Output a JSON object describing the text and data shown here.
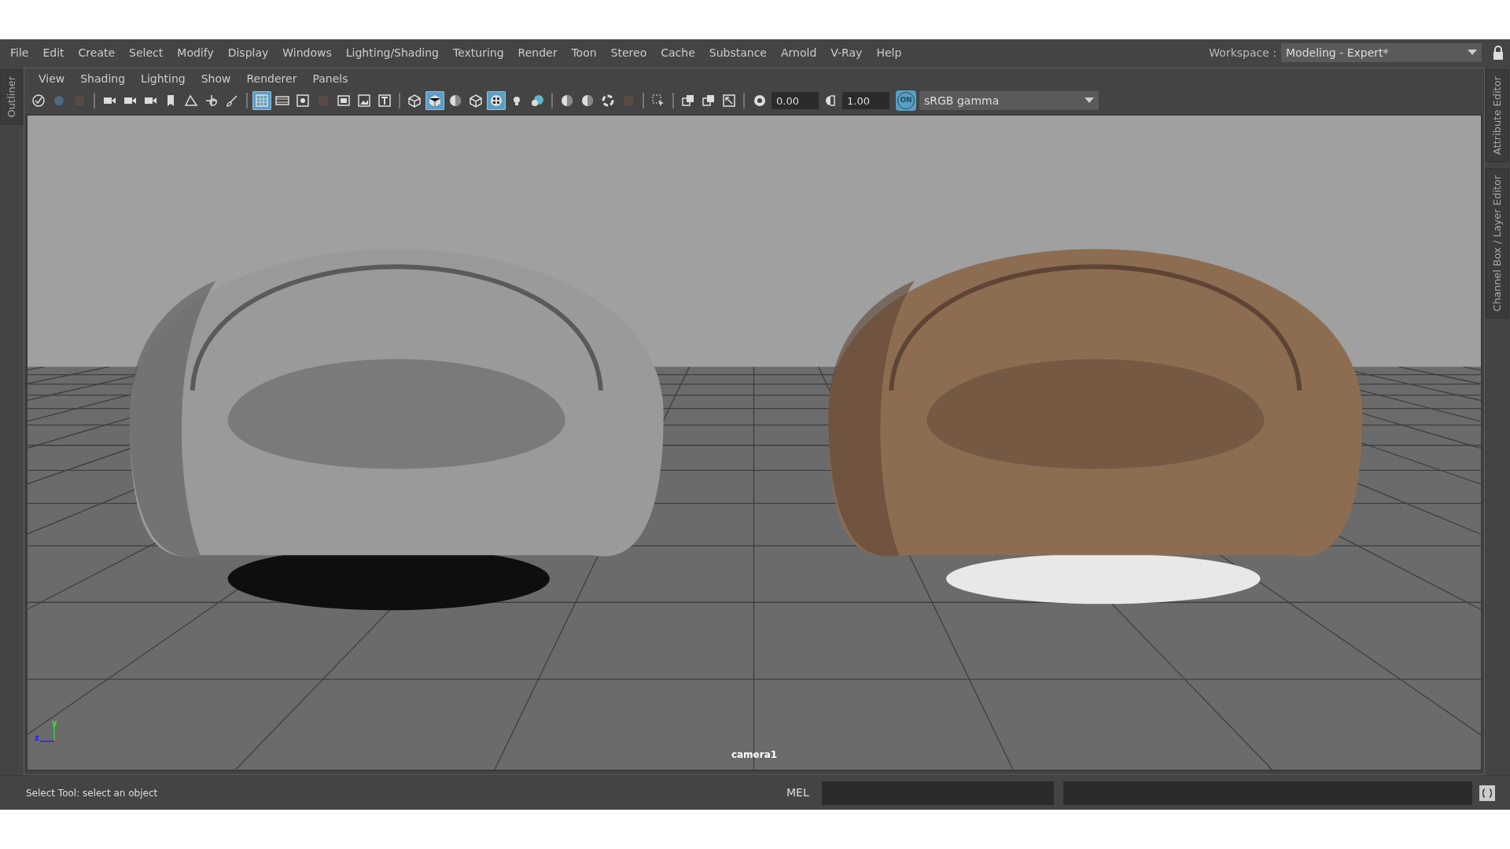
{
  "menu_bar": {
    "items": [
      "File",
      "Edit",
      "Create",
      "Select",
      "Modify",
      "Display",
      "Windows",
      "Lighting/Shading",
      "Texturing",
      "Render",
      "Toon",
      "Stereo",
      "Cache",
      "Substance",
      "Arnold",
      "V-Ray",
      "Help"
    ],
    "workspace_label": "Workspace :",
    "workspace": "Modeling - Expert*"
  },
  "side_tabs": {
    "left": [
      "Outliner"
    ],
    "right": [
      "Attribute Editor",
      "Channel Box / Layer Editor"
    ]
  },
  "panel": {
    "menu": [
      "View",
      "Shading",
      "Lighting",
      "Show",
      "Renderer",
      "Panels"
    ],
    "toolbar": {
      "toggles": [
        {
          "selected": true
        },
        {
          "selected": false
        },
        {
          "selected": false
        },
        {
          "selected": false
        },
        {
          "selected": false
        },
        {
          "selected": false
        },
        {
          "selected": false
        },
        {
          "selected": false
        },
        {
          "selected": true
        },
        {
          "selected": false
        },
        {
          "selected": false
        },
        {
          "selected": true
        },
        {
          "selected": false
        },
        {
          "selected": false
        }
      ],
      "exposure": "0.00",
      "gamma": "1.00",
      "color_management": {
        "on": true,
        "label": "ON"
      },
      "view_transform": "sRGB gamma"
    },
    "viewport": {
      "camera": "camera1",
      "axis_labels": [
        "y",
        "z"
      ]
    }
  },
  "status_bar": {
    "message": "Select Tool: select an object",
    "command_language": "MEL"
  }
}
